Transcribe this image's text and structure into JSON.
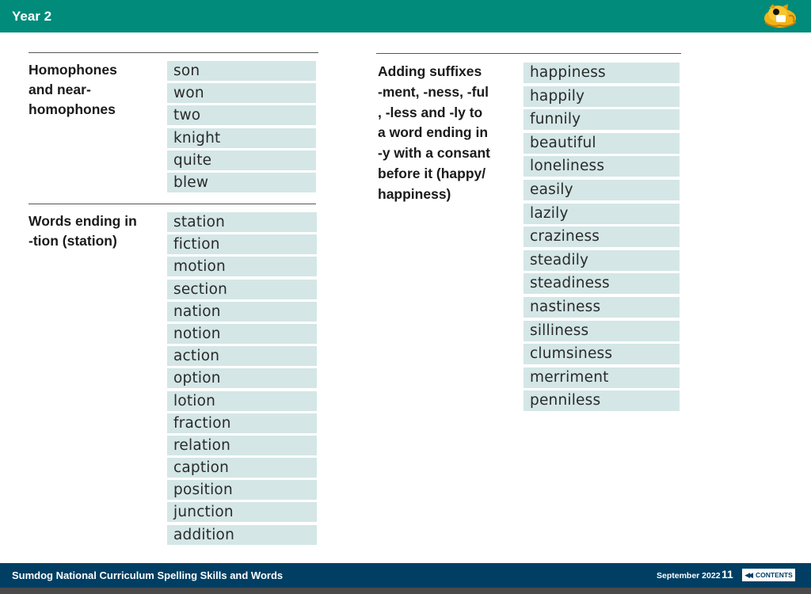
{
  "header": {
    "title": "Year 2",
    "mascot_icon": "sumdog-mascot-icon",
    "accent_color": "#008b7a"
  },
  "sections": [
    {
      "title": "Homophones and near-homophones",
      "title_lines": [
        "Homophones",
        "and near-",
        "homophones"
      ],
      "words": [
        "son",
        "won",
        "two",
        "knight",
        "quite",
        "blew"
      ]
    },
    {
      "title": "Words ending in -tion (station)",
      "title_lines": [
        "Words ending in",
        "-tion (station)"
      ],
      "words": [
        "station",
        "fiction",
        "motion",
        "section",
        "nation",
        "notion",
        "action",
        "option",
        "lotion",
        "fraction",
        "relation",
        "caption",
        "position",
        "junction",
        "addition"
      ]
    },
    {
      "title": "Adding suffixes -ment, -ness, -ful , -less and -ly to a word ending in -y with a consant before it (happy/ happiness)",
      "title_lines": [
        "Adding suffixes",
        "-ment, -ness, -ful",
        ", -less and -ly to",
        "a word ending in",
        "-y with a consant",
        "before it (happy/",
        "happiness)"
      ],
      "words": [
        "happiness",
        "happily",
        "funnily",
        "beautiful",
        "loneliness",
        "easily",
        "lazily",
        "craziness",
        "steadily",
        "steadiness",
        "nastiness",
        "silliness",
        "clumsiness",
        "merriment",
        "penniless"
      ]
    }
  ],
  "footer": {
    "title": "Sumdog National Curriculum Spelling Skills and Words",
    "date": "September 2022",
    "page_number": "11",
    "contents_label": "CONTENTS",
    "contents_icon": "double-chevron-left-icon",
    "color": "#003f63"
  },
  "colors": {
    "word_cell_bg": "#d4e6e6"
  }
}
